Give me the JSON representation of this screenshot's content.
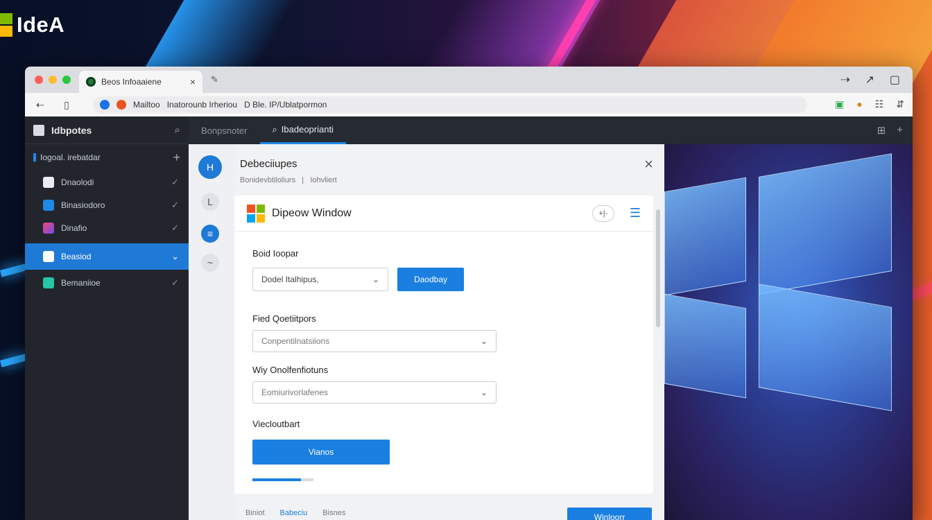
{
  "brand": {
    "name": "IdeA"
  },
  "browser": {
    "tab_label": "Beos Infoaaiene",
    "tab_close": "×",
    "new_tab": "✎",
    "window_controls": [
      "⇢",
      "↗",
      "▢"
    ],
    "nav": {
      "back": "⇠",
      "page": "▯"
    },
    "address": {
      "site": "Mailtoo",
      "segment1": "Inatorounb Irheriou",
      "segment2": "D Ble. IP/Ublatpormon"
    },
    "extensions": [
      "▣",
      "●",
      "☷",
      "⇵"
    ]
  },
  "sidebar": {
    "title": "Idbpotes",
    "section_label": "Iogoal. irebatdar",
    "section_add": "+",
    "items": [
      {
        "label": "Dnaolodi",
        "icon_color": "#e9ecf0",
        "check": "✓"
      },
      {
        "label": "Binasiodoro",
        "icon_color": "#1e88e5",
        "check": "✓"
      },
      {
        "label": "Dinafio",
        "icon_color": "#e64a7a",
        "check": "✓"
      },
      {
        "label": "Beasiod",
        "icon_color": "#ffffff",
        "check": "✓",
        "active": true
      },
      {
        "label": "Bemaniioe",
        "icon_color": "#26c6a6",
        "check": "✓"
      }
    ]
  },
  "topnav": {
    "tabs": [
      {
        "label": "Bonpsnoter"
      },
      {
        "label": "Ibadeoprianti",
        "active": true
      }
    ],
    "right_icons": [
      "⊞",
      "+"
    ]
  },
  "rail": [
    {
      "glyph": "H"
    },
    {
      "glyph": "L"
    },
    {
      "glyph": "≡"
    },
    {
      "glyph": "~"
    }
  ],
  "panel": {
    "title": "Debeciiupes",
    "subtitle_left": "Bonidevbtiloliurs",
    "subtitle_sep": "|",
    "subtitle_right": "Iohvliert",
    "close": "×",
    "card": {
      "title": "Dipeow Window",
      "pill": "+|-",
      "menu": "☰",
      "field1_label": "Boid Ioopar",
      "field1_value": "Dodel Italhipus,",
      "field1_button": "Daodbay",
      "field2_label": "Fied Qoetiitpors",
      "field2_value": "Conpentilnatsiions",
      "field3_label": "Wiy Onolfenfiotuns",
      "field3_value": "Eomiurivorlafenes",
      "field4_label": "Viecloutbart",
      "field4_button": "Vianos",
      "progress": 0.8
    },
    "footer": {
      "link1": "Biniot",
      "link2": "Babeciu",
      "link3": "Bisnes",
      "button": "Winloorr"
    }
  },
  "colors": {
    "accent": "#1a7fe0",
    "win_red": "#f25022",
    "win_green": "#7fba00",
    "win_blue": "#00a4ef",
    "win_yellow": "#ffb900"
  }
}
